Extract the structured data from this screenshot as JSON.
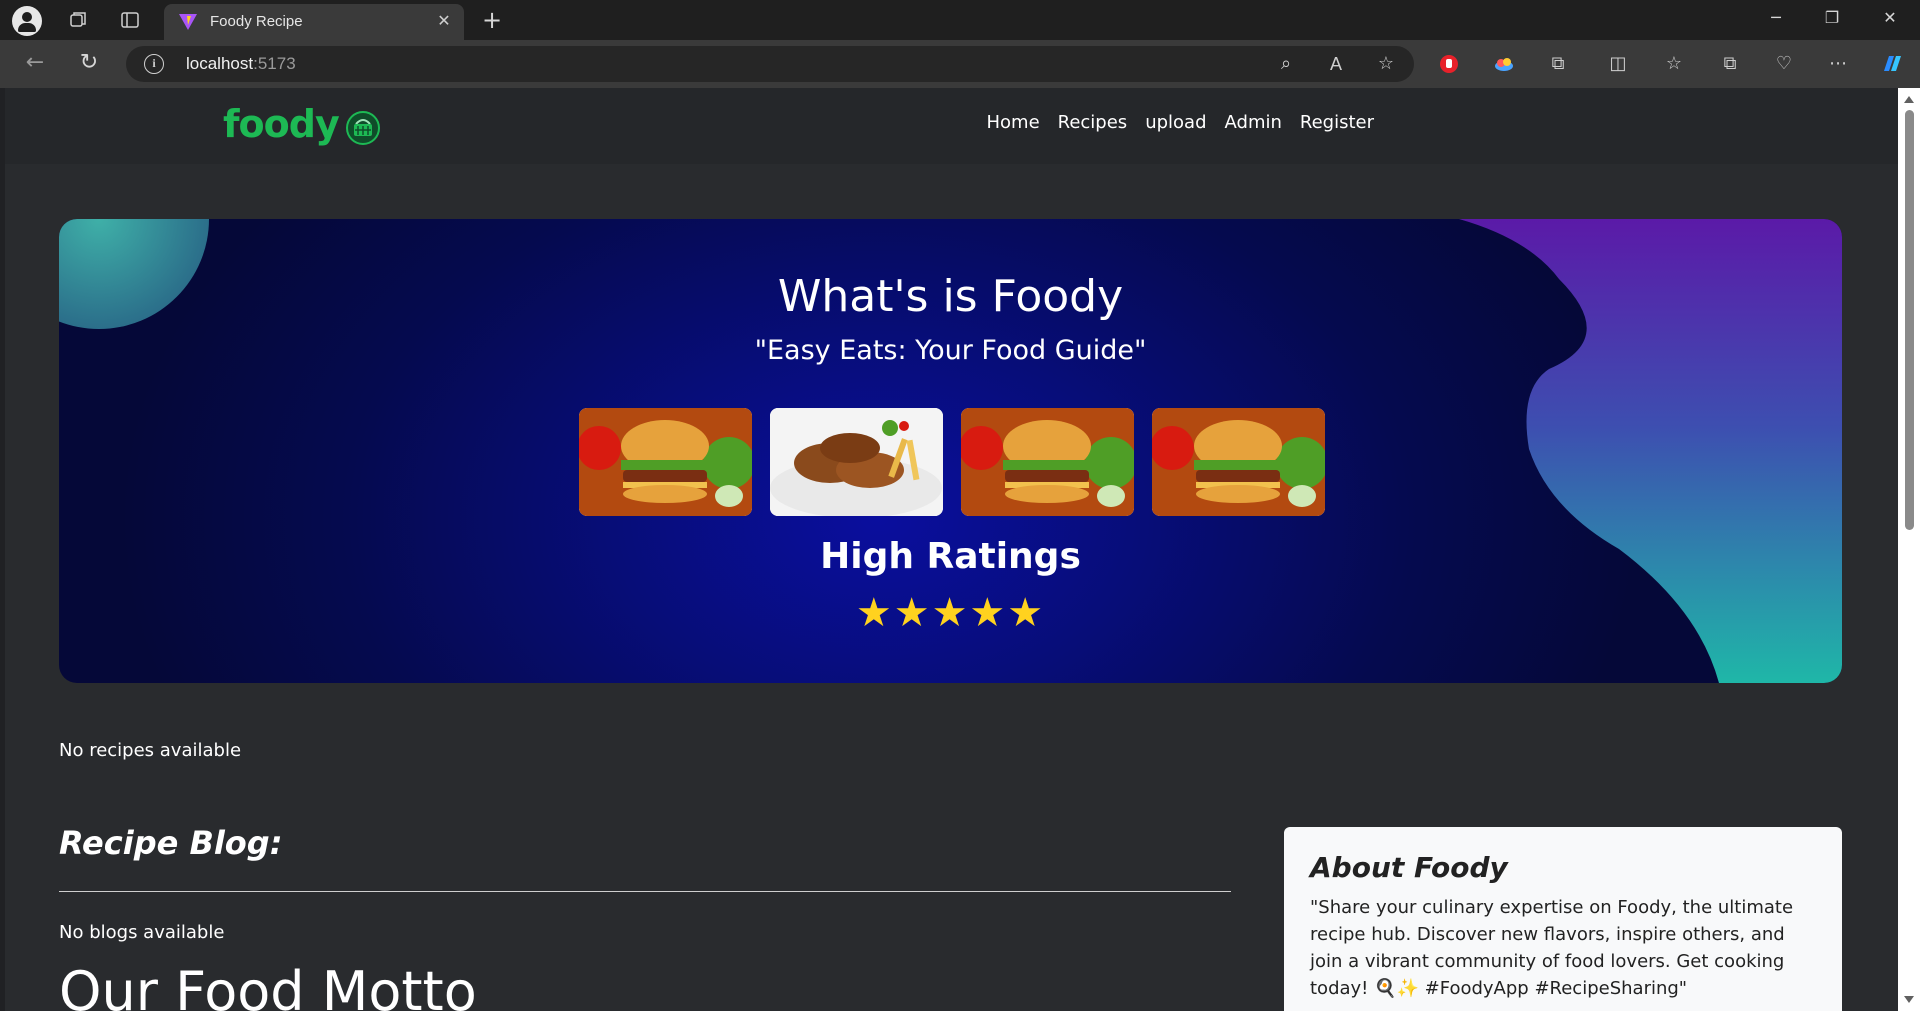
{
  "browser": {
    "tab_title": "Foody Recipe",
    "url_host": "localhost",
    "url_port": ":5173"
  },
  "site": {
    "logo_text": "foody",
    "nav": [
      "Home",
      "Recipes",
      "upload",
      "Admin",
      "Register"
    ]
  },
  "hero": {
    "title": "What's is Foody",
    "subtitle": "\"Easy Eats: Your Food Guide\"",
    "images": [
      "burger",
      "fried-chicken",
      "burger",
      "burger"
    ],
    "rating_heading": "High Ratings",
    "stars": "★★★★★",
    "rating": 5
  },
  "recipes": {
    "empty_text": "No recipes available"
  },
  "blog": {
    "heading": "Recipe Blog:",
    "empty_text": "No blogs available",
    "motto_heading": "Our Food Motto"
  },
  "about": {
    "title": "About Foody",
    "text": "\"Share your culinary expertise on Foody, the ultimate recipe hub. Discover new flavors, inspire others, and join a vibrant community of food lovers. Get cooking today! 🍳✨ #FoodyApp #RecipeSharing\""
  },
  "colors": {
    "brand": "#1db954",
    "hero_bg": "#070d78",
    "page_bg": "#292b2e",
    "stars": "#ffd21f"
  }
}
